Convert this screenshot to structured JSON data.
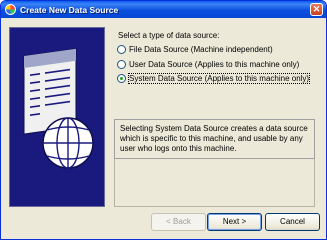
{
  "window": {
    "title": "Create New Data Source",
    "close_label": "✕"
  },
  "content": {
    "prompt": "Select a type of data source:",
    "options": [
      {
        "label": "File Data Source (Machine independent)",
        "selected": false
      },
      {
        "label": "User Data Source (Applies to this machine only)",
        "selected": false
      },
      {
        "label": "System Data Source (Applies to this machine only)",
        "selected": true
      }
    ],
    "description": "Selecting System Data Source creates a data source which is specific to this machine, and usable by any user who logs onto this machine."
  },
  "buttons": {
    "back": "< Back",
    "next": "Next >",
    "cancel": "Cancel"
  },
  "icons": {
    "side_art": "database-globe-icon",
    "app": "odbc-icon"
  },
  "colors": {
    "titlebar": "#0a50df",
    "side_art_bg": "#1a1a7e",
    "radio_dot": "#21a121"
  }
}
